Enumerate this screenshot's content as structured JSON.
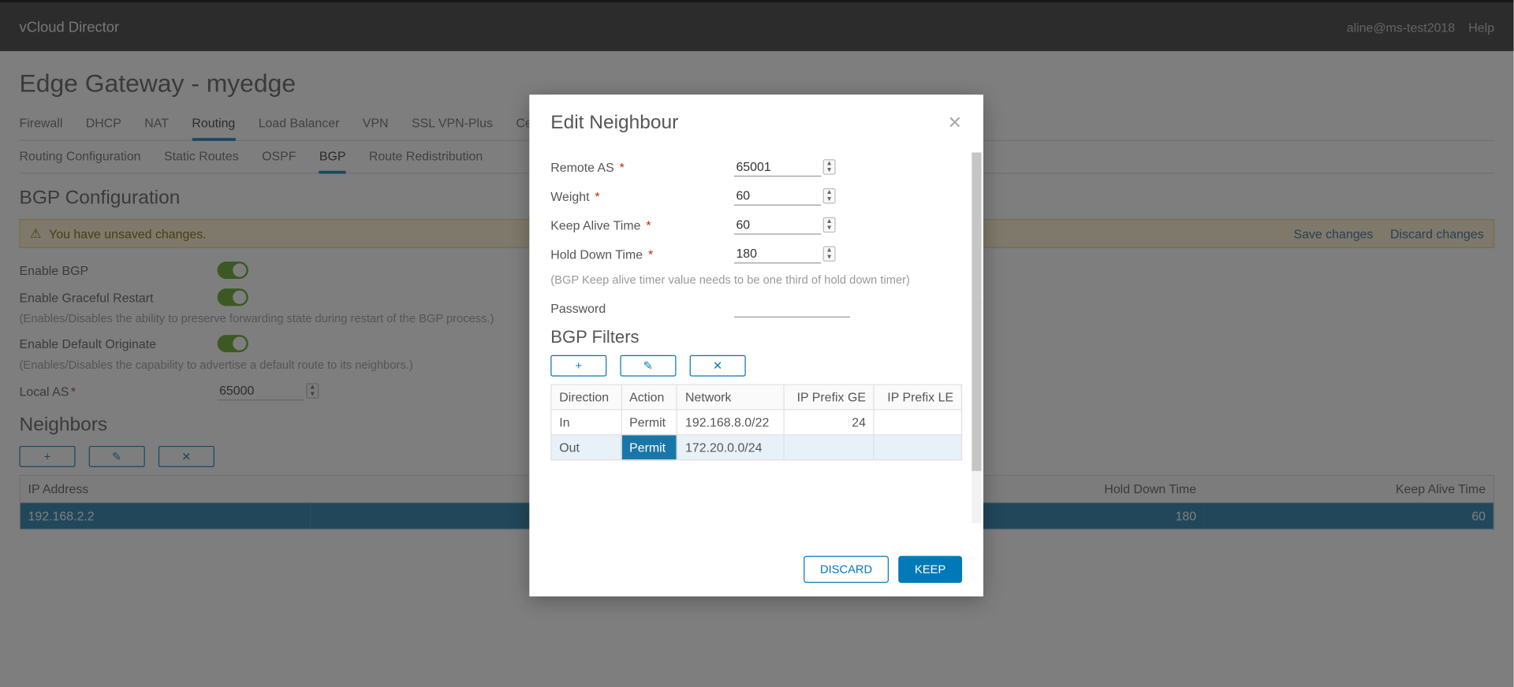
{
  "topbar": {
    "brand": "vCloud Director",
    "user": "aline@ms-test2018",
    "help": "Help"
  },
  "page": {
    "title": "Edge Gateway - myedge"
  },
  "tabs": [
    "Firewall",
    "DHCP",
    "NAT",
    "Routing",
    "Load Balancer",
    "VPN",
    "SSL VPN-Plus",
    "Certificates"
  ],
  "tabs_active": 3,
  "subtabs": [
    "Routing Configuration",
    "Static Routes",
    "OSPF",
    "BGP",
    "Route Redistribution"
  ],
  "subtabs_active": 3,
  "section": {
    "title": "BGP Configuration"
  },
  "alert": {
    "text": "You have unsaved changes.",
    "save": "Save changes",
    "discard": "Discard changes"
  },
  "bgp": {
    "enable_label": "Enable BGP",
    "enable_val": true,
    "graceful_label": "Enable Graceful Restart",
    "graceful_val": true,
    "graceful_help": "(Enables/Disables the ability to preserve forwarding state during restart of the BGP process.)",
    "default_orig_label": "Enable Default Originate",
    "default_orig_val": true,
    "default_orig_help": "(Enables/Disables the capability to advertise a default route to its neighbors.)",
    "local_as_label": "Local AS",
    "local_as_val": "65000"
  },
  "neighbors": {
    "title": "Neighbors",
    "cols": [
      "IP Address",
      "Hold Down Time",
      "Keep Alive Time"
    ],
    "rows": [
      {
        "ip": "192.168.2.2",
        "hold_down": "180",
        "keep_alive": "60",
        "selected": true
      }
    ]
  },
  "modal": {
    "title": "Edit Neighbour",
    "fields": {
      "remote_as_label": "Remote AS",
      "remote_as_val": "65001",
      "weight_label": "Weight",
      "weight_val": "60",
      "keep_alive_label": "Keep Alive Time",
      "keep_alive_val": "60",
      "hold_down_label": "Hold Down Time",
      "hold_down_val": "180",
      "note": "(BGP Keep alive timer value needs to be one third of hold down timer)",
      "password_label": "Password",
      "password_val": ""
    },
    "filters": {
      "title": "BGP Filters",
      "cols": [
        "Direction",
        "Action",
        "Network",
        "IP Prefix GE",
        "IP Prefix LE"
      ],
      "rows": [
        {
          "dir": "In",
          "action": "Permit",
          "network": "192.168.8.0/22",
          "ge": "24",
          "le": "",
          "selected": false
        },
        {
          "dir": "Out",
          "action": "Permit",
          "network": "172.20.0.0/24",
          "ge": "",
          "le": "",
          "selected": true
        }
      ]
    },
    "buttons": {
      "discard": "DISCARD",
      "keep": "KEEP"
    }
  },
  "icons": {
    "plus": "+",
    "edit": "✎",
    "remove": "✕",
    "close": "✕",
    "warn": "⚠"
  }
}
